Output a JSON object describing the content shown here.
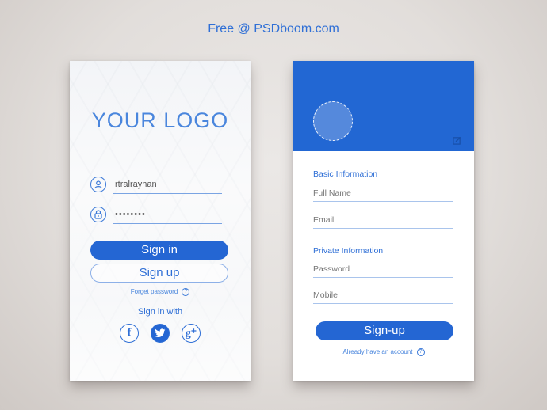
{
  "credit": "Free @ PSDboom.com",
  "login_card": {
    "logo": "YOUR LOGO",
    "username": {
      "value": "rtralrayhan",
      "icon": "user-icon"
    },
    "password": {
      "value": "••••••••",
      "icon": "lock-icon"
    },
    "sign_in_label": "Sign in",
    "sign_up_label": "Sign up",
    "forgot_label": "Forget password",
    "help_icon": "?",
    "sign_in_with_label": "Sign in with",
    "socials": [
      {
        "name": "facebook",
        "glyph": "f"
      },
      {
        "name": "twitter",
        "glyph": "🐦"
      },
      {
        "name": "google-plus",
        "glyph": "g⁺"
      }
    ]
  },
  "signup_card": {
    "basic_title": "Basic Information",
    "full_name_placeholder": "Full Name",
    "email_placeholder": "Email",
    "private_title": "Private Information",
    "password_placeholder": "Password",
    "mobile_placeholder": "Mobile",
    "signup_label": "Sign-up",
    "already_label": "Already have an account",
    "help_icon": "?"
  },
  "colors": {
    "accent": "#2466d3",
    "header": "#2267d3",
    "text_blue": "#2f6fd6"
  }
}
